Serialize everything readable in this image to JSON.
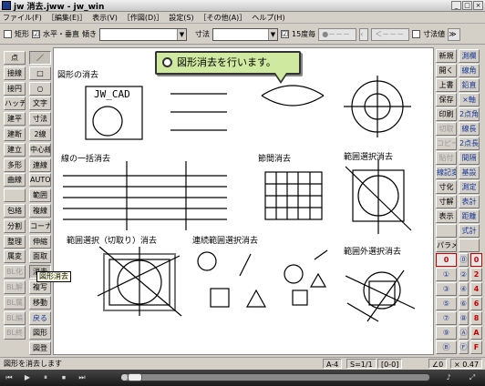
{
  "window": {
    "title": "jw 消去.jww - jw_win",
    "icon": "jw-app-icon",
    "controls": [
      "_",
      "□",
      "×"
    ]
  },
  "menu": [
    "ファイル(F)",
    "［編集(E)］",
    "表示(V)",
    "［作図(D)］",
    "設定(S)",
    "［その他(A)］",
    "ヘルプ(H)"
  ],
  "toolbar": {
    "rect_label": "矩形",
    "hv_label": "水平・垂直",
    "angle_label": "傾き",
    "size_label": "寸法",
    "deg15_label": "15度毎",
    "dimval_label": "寸法値",
    "hv_checked": "☑",
    "deg15_checked": "☑"
  },
  "left_tools": {
    "col1": [
      "点",
      "接線",
      "接円",
      "ハッチ",
      "建平",
      "建断",
      "建立",
      "多形",
      "曲線",
      "",
      "包絡",
      "分割",
      "整理",
      "属変",
      "BL化",
      "BL解",
      "BL属",
      "BL編",
      "BL終"
    ],
    "col2": [
      "／",
      "□",
      "○",
      "文字",
      "寸法",
      "2線",
      "中心線",
      "連線",
      "AUTO",
      "範囲",
      "複線",
      "コーナー",
      "伸縮",
      "面取",
      "消去",
      "複写",
      "移動",
      "戻る",
      "図形",
      "図登"
    ]
  },
  "tooltip": "図形消去",
  "callout": "図形消去を行います。",
  "canvas_labels": {
    "section1": "図形の消去",
    "jwcad": "JW_CAD",
    "section2": "線の一括消去",
    "section3": "節間消去",
    "section4": "範囲選択消去",
    "section5": "範囲選択（切取り）消去",
    "section6": "連続範囲選択消去",
    "section7": "範囲外選択消去"
  },
  "right_tools": {
    "col1": [
      "新規",
      "開く",
      "上書",
      "保存",
      "印刷",
      "切取",
      "コピー",
      "貼付",
      "線記変",
      "寸化",
      "寸解",
      "表示",
      "",
      "パラメ",
      "0",
      "①",
      "③",
      "⑤",
      "⑦",
      "⑨",
      "Ⓑ"
    ],
    "col2": [
      "測欄",
      "線角",
      "鉛直",
      "×軸",
      "2点角",
      "線長",
      "2点長",
      "間隔",
      "基設",
      "測定",
      "表計",
      "距離",
      "式計",
      "",
      "⓪",
      "②",
      "④",
      "⑥",
      "⑧",
      "Ⓐ",
      "Ⓕ"
    ],
    "col3": [
      "",
      "",
      "",
      "",
      "",
      "",
      "",
      "",
      "",
      "",
      "",
      "",
      "",
      "",
      "0",
      "2",
      "4",
      "6",
      "8",
      "A",
      "F"
    ]
  },
  "status": {
    "message": "図形を消去します",
    "paper": "A-4",
    "scale": "S=1/1",
    "layer": "[0-0]",
    "extra": "∠0",
    "zoom": "× 0.47"
  },
  "player": {
    "buttons": [
      "⏮",
      "▶",
      "⏸",
      "⏹",
      "⏭"
    ],
    "progress": 0.02,
    "right_icons": [
      "♪",
      "⤢"
    ]
  },
  "colors": {
    "callout_bg": "#cfeaa0",
    "canvas_bg": "#ffffff",
    "accent_blue": "#1a3a9a",
    "accent_red": "#cc0000"
  }
}
